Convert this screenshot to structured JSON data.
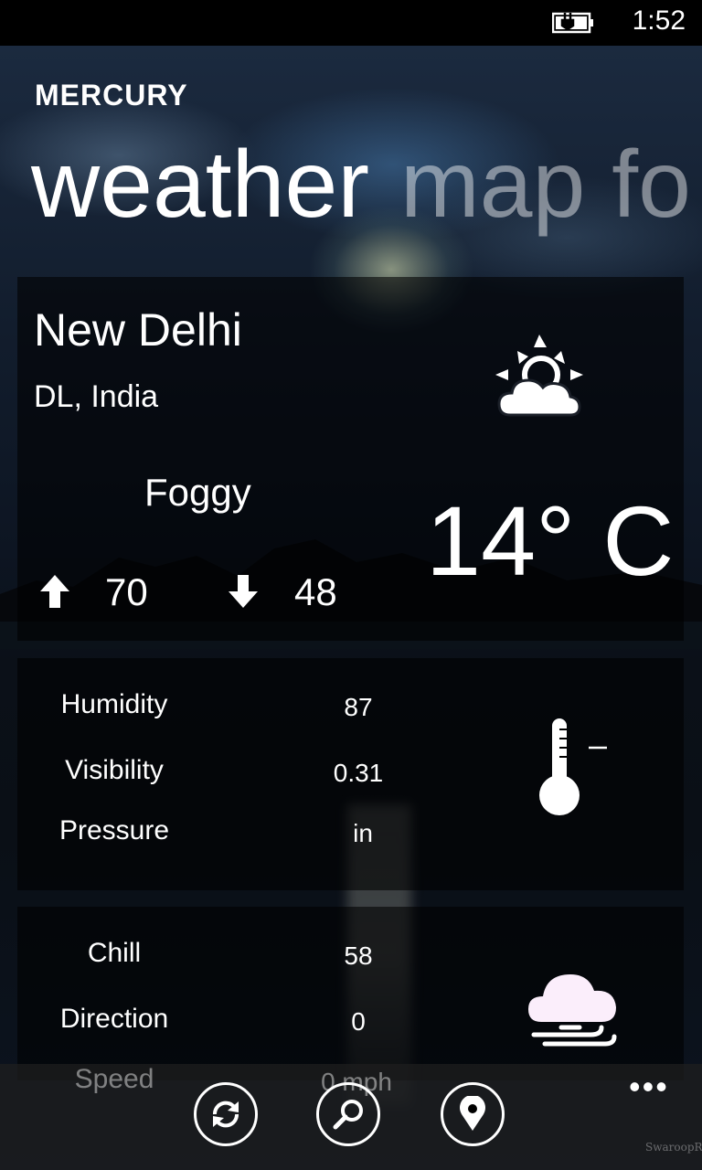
{
  "status_bar": {
    "time": "1:52",
    "battery_icon": "battery-charging-icon"
  },
  "header": {
    "app_title": "MERCURY",
    "pivot": [
      {
        "label": "weather"
      },
      {
        "label": "map fo"
      }
    ]
  },
  "current": {
    "city": "New Delhi",
    "region": "DL, India",
    "condition": "Foggy",
    "temperature": "14° C",
    "high": "70",
    "low": "48",
    "condition_icon": "partly-cloudy-icon"
  },
  "details": {
    "rows": [
      {
        "label": "Humidity",
        "value": "87"
      },
      {
        "label": "Visibility",
        "value": "0.31"
      },
      {
        "label": "Pressure",
        "value": "in"
      }
    ],
    "icon": "thermometer-icon"
  },
  "wind": {
    "rows": [
      {
        "label": "Chill",
        "value": "58"
      },
      {
        "label": "Direction",
        "value": "0"
      },
      {
        "label": "Speed",
        "value": "0 mph"
      }
    ],
    "icon": "windy-cloud-icon"
  },
  "app_bar": {
    "buttons": [
      {
        "icon": "refresh-icon"
      },
      {
        "icon": "search-icon"
      },
      {
        "icon": "location-icon"
      }
    ],
    "more": "•••"
  },
  "watermark": "SwaroopR"
}
